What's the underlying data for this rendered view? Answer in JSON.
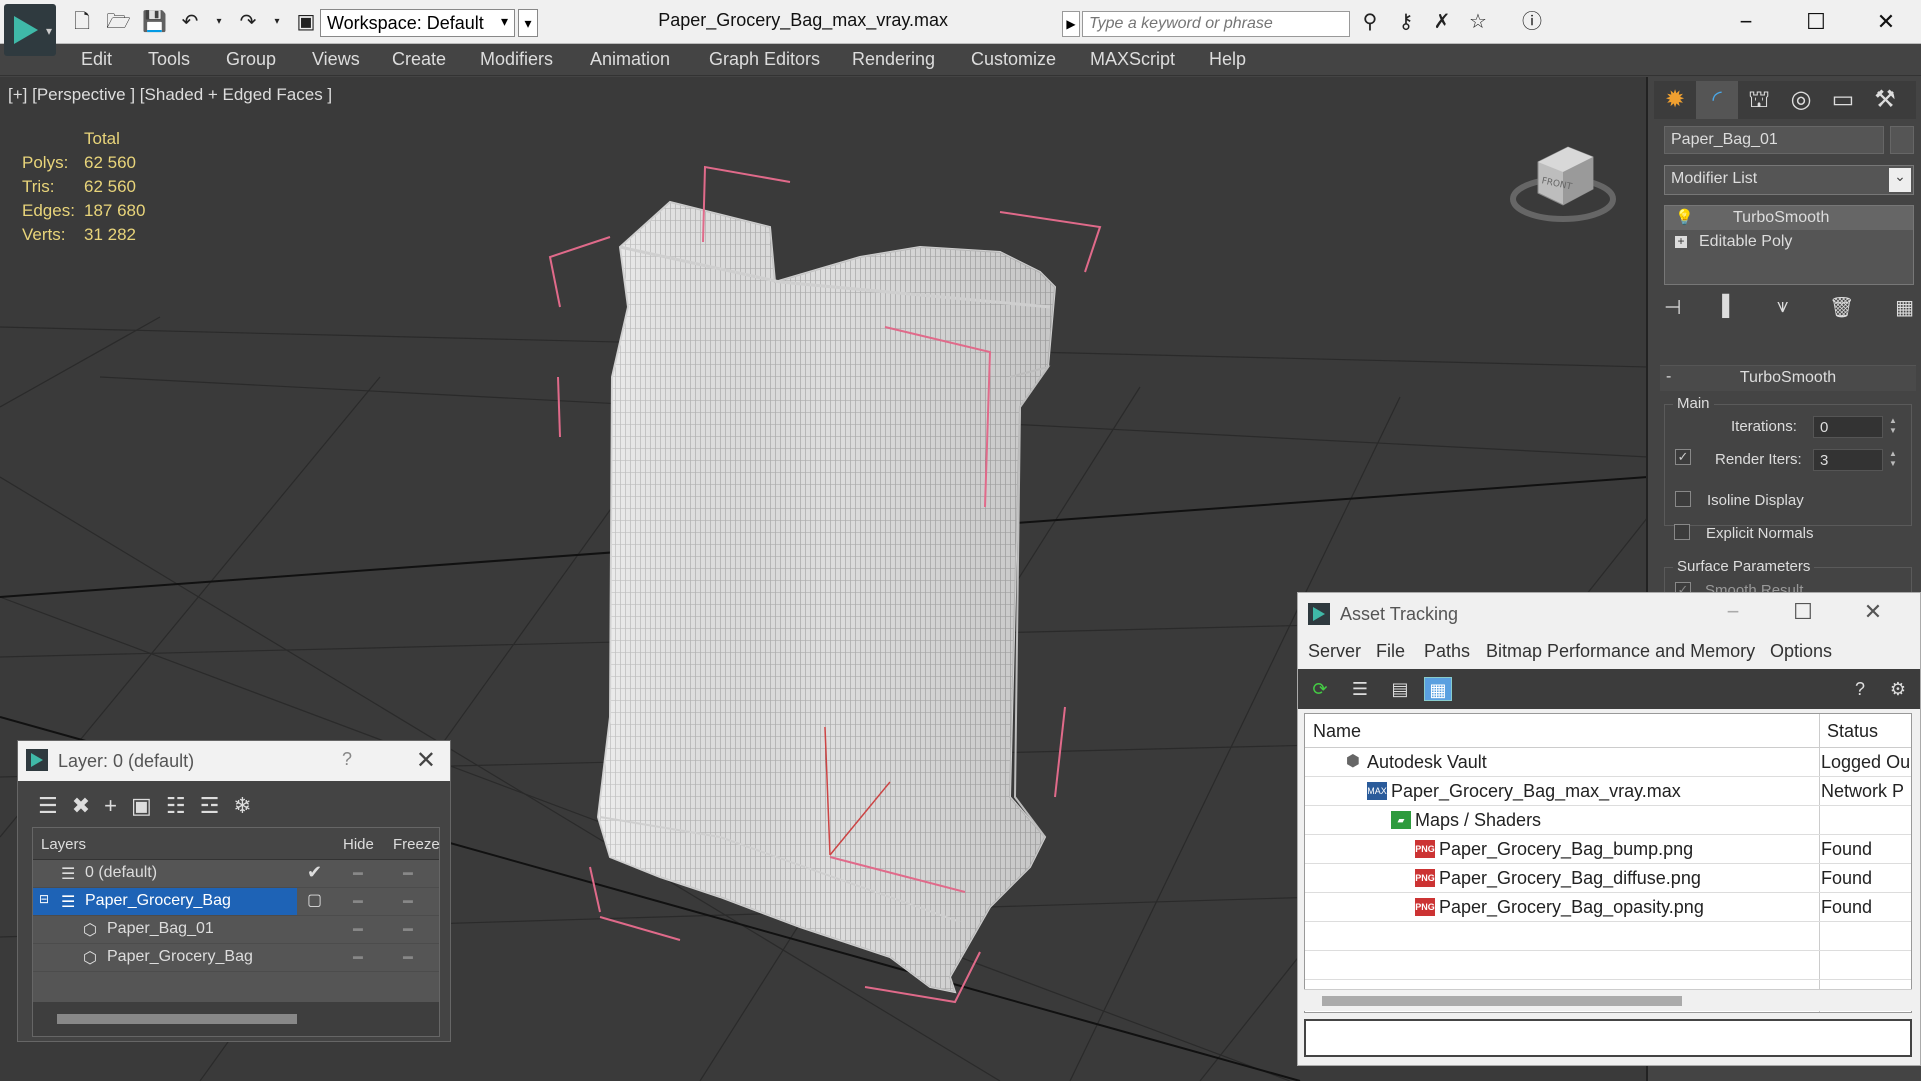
{
  "titlebar": {
    "workspace": "Workspace: Default",
    "document_title": "Paper_Grocery_Bag_max_vray.max",
    "search_placeholder": "Type a keyword or phrase"
  },
  "menu": [
    "Edit",
    "Tools",
    "Group",
    "Views",
    "Create",
    "Modifiers",
    "Animation",
    "Graph Editors",
    "Rendering",
    "Customize",
    "MAXScript",
    "Help"
  ],
  "viewport": {
    "label": "[+] [Perspective ] [Shaded + Edged Faces ]",
    "stats": {
      "total_label": "Total",
      "polys_label": "Polys:",
      "polys": "62 560",
      "tris_label": "Tris:",
      "tris": "62 560",
      "edges_label": "Edges:",
      "edges": "187 680",
      "verts_label": "Verts:",
      "verts": "31 282"
    },
    "viewcube_label": "FRONT"
  },
  "command_panel": {
    "object_name": "Paper_Bag_01",
    "modifier_list": "Modifier List",
    "stack": [
      "TurboSmooth",
      "Editable Poly"
    ],
    "rollout_title": "TurboSmooth",
    "main_group": "Main",
    "iterations_label": "Iterations:",
    "iterations": "0",
    "render_iters_label": "Render Iters:",
    "render_iters": "3",
    "isoline_label": "Isoline Display",
    "explicit_normals_label": "Explicit Normals",
    "surface_group": "Surface Parameters",
    "smooth_result_label": "Smooth Result"
  },
  "layer_dialog": {
    "title": "Layer: 0 (default)",
    "help": "?",
    "col_layers": "Layers",
    "col_hide": "Hide",
    "col_freeze": "Freeze",
    "rows": [
      {
        "name": "0 (default)"
      },
      {
        "name": "Paper_Grocery_Bag"
      },
      {
        "name": "Paper_Bag_01"
      },
      {
        "name": "Paper_Grocery_Bag"
      }
    ]
  },
  "asset_tracking": {
    "title": "Asset Tracking",
    "menu": [
      "Server",
      "File",
      "Paths",
      "Bitmap Performance and Memory",
      "Options"
    ],
    "col_name": "Name",
    "col_status": "Status",
    "rows": [
      {
        "name": "Autodesk Vault",
        "status": "Logged Ou"
      },
      {
        "name": "Paper_Grocery_Bag_max_vray.max",
        "status": "Network P"
      },
      {
        "name": "Maps / Shaders",
        "status": ""
      },
      {
        "name": "Paper_Grocery_Bag_bump.png",
        "status": "Found"
      },
      {
        "name": "Paper_Grocery_Bag_diffuse.png",
        "status": "Found"
      },
      {
        "name": "Paper_Grocery_Bag_opasity.png",
        "status": "Found"
      }
    ]
  }
}
